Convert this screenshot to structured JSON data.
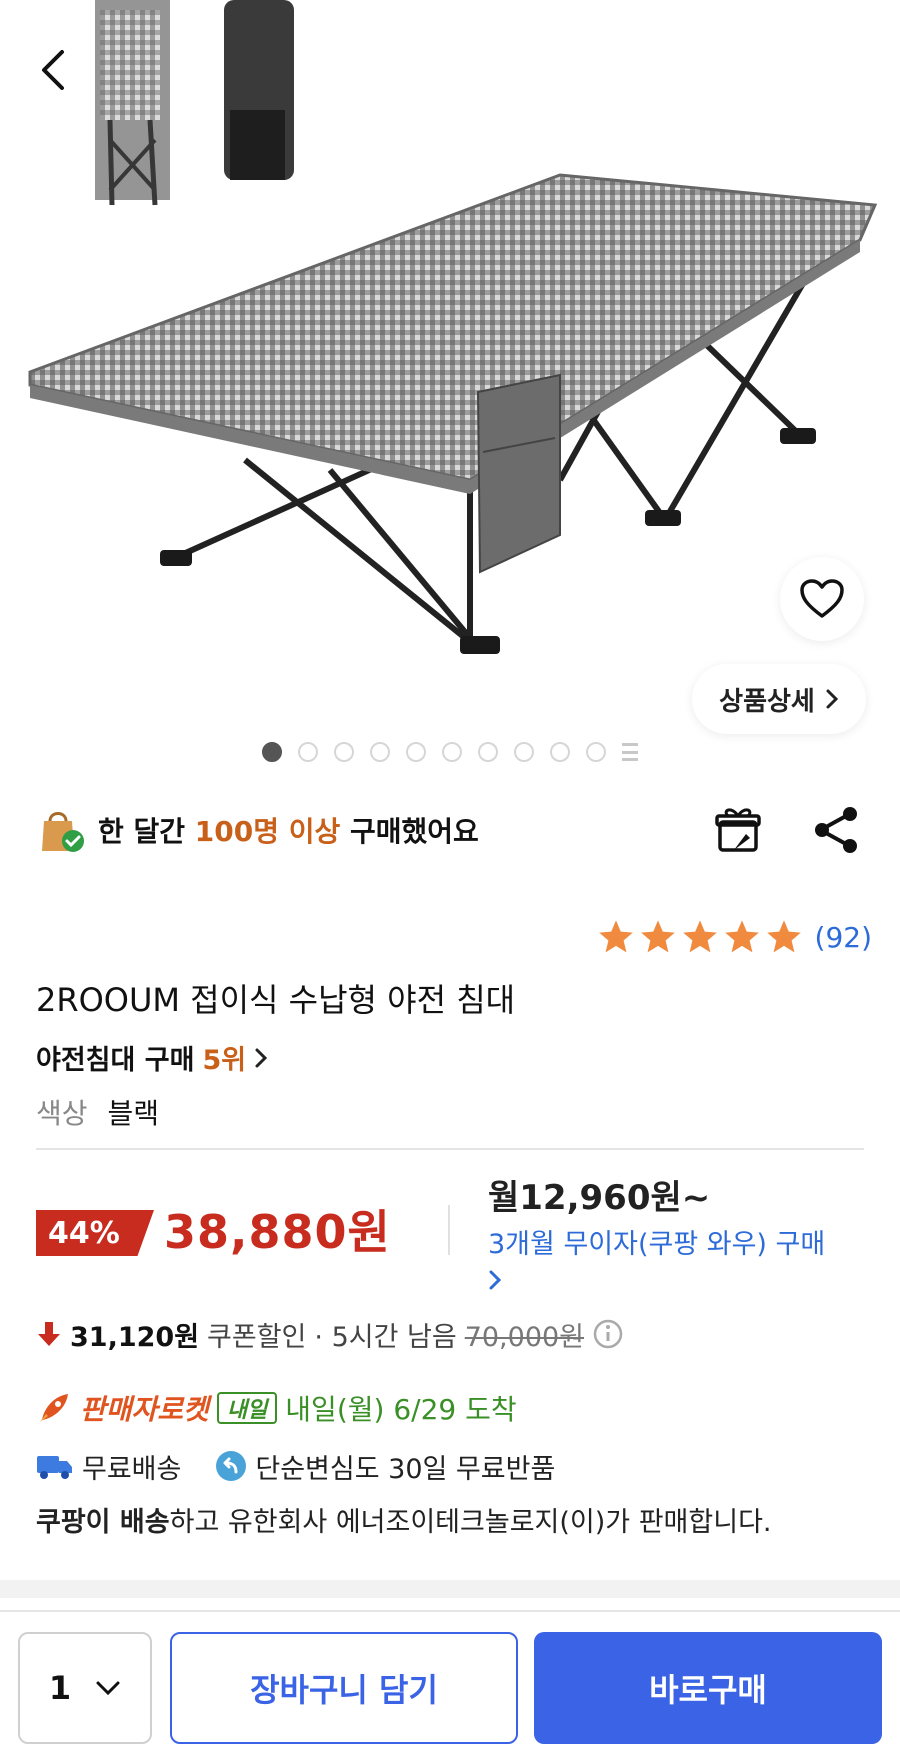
{
  "hero": {
    "detail_label": "상품상세",
    "image_count": 11,
    "active_index": 0
  },
  "buyers": {
    "prefix": "한 달간 ",
    "highlight": "100명 이상",
    "suffix": " 구매했어요"
  },
  "rating": {
    "stars": 5,
    "count": "(92)",
    "star_color": "#f08a3e"
  },
  "product": {
    "title": "2ROOUM 접이식 수납형 야전 침대",
    "rank_label": "야전침대 구매",
    "rank_value": "5위",
    "option_label": "색상",
    "option_value": "블랙"
  },
  "price": {
    "discount": "44%",
    "sale": "38,880원",
    "monthly": "월12,960원~",
    "monthly_link": "3개월 무이자(쿠팡 와우) 구매"
  },
  "coupon": {
    "amount": "31,120원",
    "label": "쿠폰할인",
    "time_left": "· 5시간 남음",
    "original": "70,000원"
  },
  "delivery": {
    "rocket_label": "판매자로켓",
    "badge": "내일",
    "arrival": "내일(월) 6/29 도착"
  },
  "shipping": {
    "free_shipping": "무료배송",
    "return_policy": "단순변심도 30일 무료반품"
  },
  "seller": {
    "bold": "쿠팡이 배송",
    "rest": "하고 유한회사 에너조이테크놀로지(이)가 판매합니다."
  },
  "bottom": {
    "quantity": "1",
    "cart_label": "장바구니 담기",
    "buy_label": "바로구매"
  },
  "colors": {
    "accent_blue": "#3a63e6",
    "sale_red": "#c72c1f",
    "highlight_orange": "#c8601a",
    "delivery_green": "#3a8f27"
  }
}
